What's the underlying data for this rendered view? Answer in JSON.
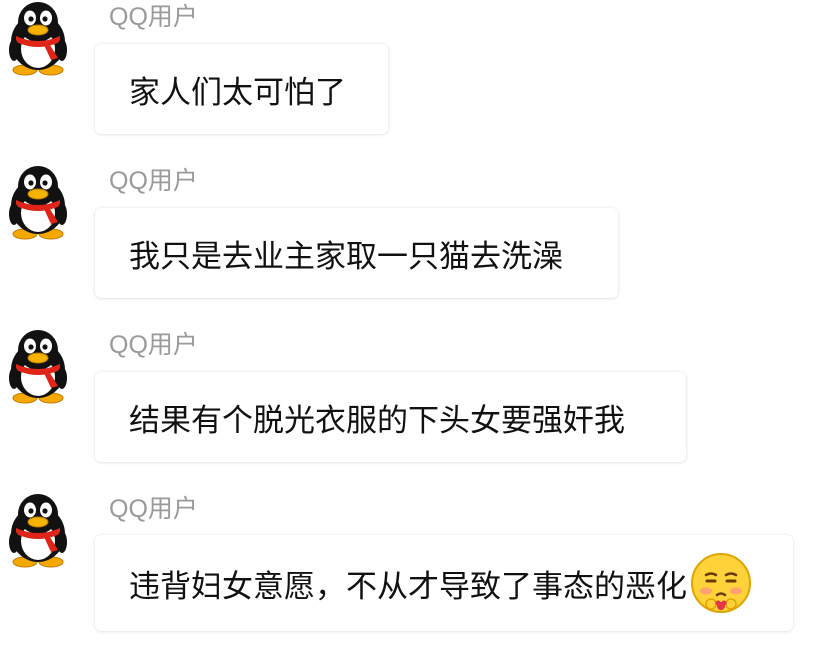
{
  "messages": [
    {
      "sender": "QQ用户",
      "text": "家人们太可怕了"
    },
    {
      "sender": "QQ用户",
      "text": "我只是去业主家取一只猫去洗澡"
    },
    {
      "sender": "QQ用户",
      "text": "结果有个脱光衣服的下头女要强奸我"
    },
    {
      "sender": "QQ用户",
      "text": "违背妇女意愿，不从才导致了事态的恶化",
      "emoji": "sly-blushing-face-emoji"
    }
  ],
  "colors": {
    "sender_name": "#9a9a9a",
    "message_text": "#111111",
    "bubble_bg": "#ffffff",
    "scarf": "#e02418"
  }
}
